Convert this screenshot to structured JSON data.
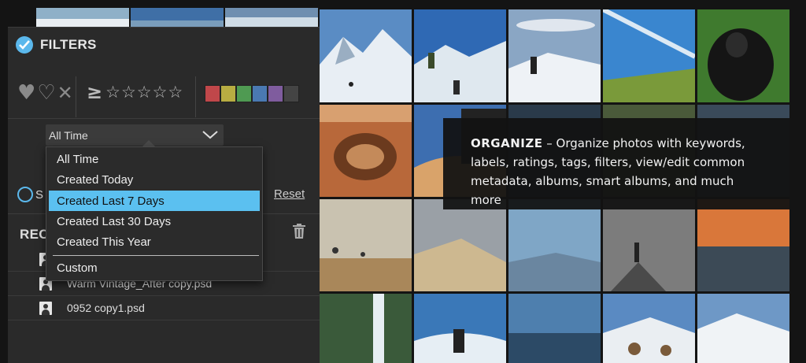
{
  "filters": {
    "title": "FILTERS",
    "heart_glyphs": [
      "♥",
      "♡",
      "✕"
    ],
    "ge_symbol": "≥",
    "stars": [
      "☆",
      "☆",
      "☆",
      "☆",
      "☆"
    ],
    "color_labels": [
      "#c0474a",
      "#b8ad42",
      "#4f9a52",
      "#4a79b2",
      "#7f5c9e",
      "#444444"
    ]
  },
  "date_select": {
    "value": "All Time",
    "options": [
      "All Time",
      "Created Today",
      "Created Last 7 Days",
      "Created Last 30 Days",
      "Created This Year",
      "Custom"
    ],
    "selected_option": "Created Last 7 Days"
  },
  "search": {
    "label_fragment": "S",
    "reset_label": "Reset"
  },
  "recent": {
    "title_fragment": "RECI",
    "files": [
      "",
      "Warm Vintage_After copy.psd",
      "0952 copy1.psd"
    ]
  },
  "overlay": {
    "heading": "ORGANIZE",
    "dash": "–",
    "body": "Organize photos with keywords, labels, ratings, tags, filters, view/edit common metadata, albums, smart albums, and much more"
  },
  "colors": {
    "accent": "#5bc0f0",
    "panel_bg": "#2a2a2a",
    "page_bg": "#141414"
  }
}
